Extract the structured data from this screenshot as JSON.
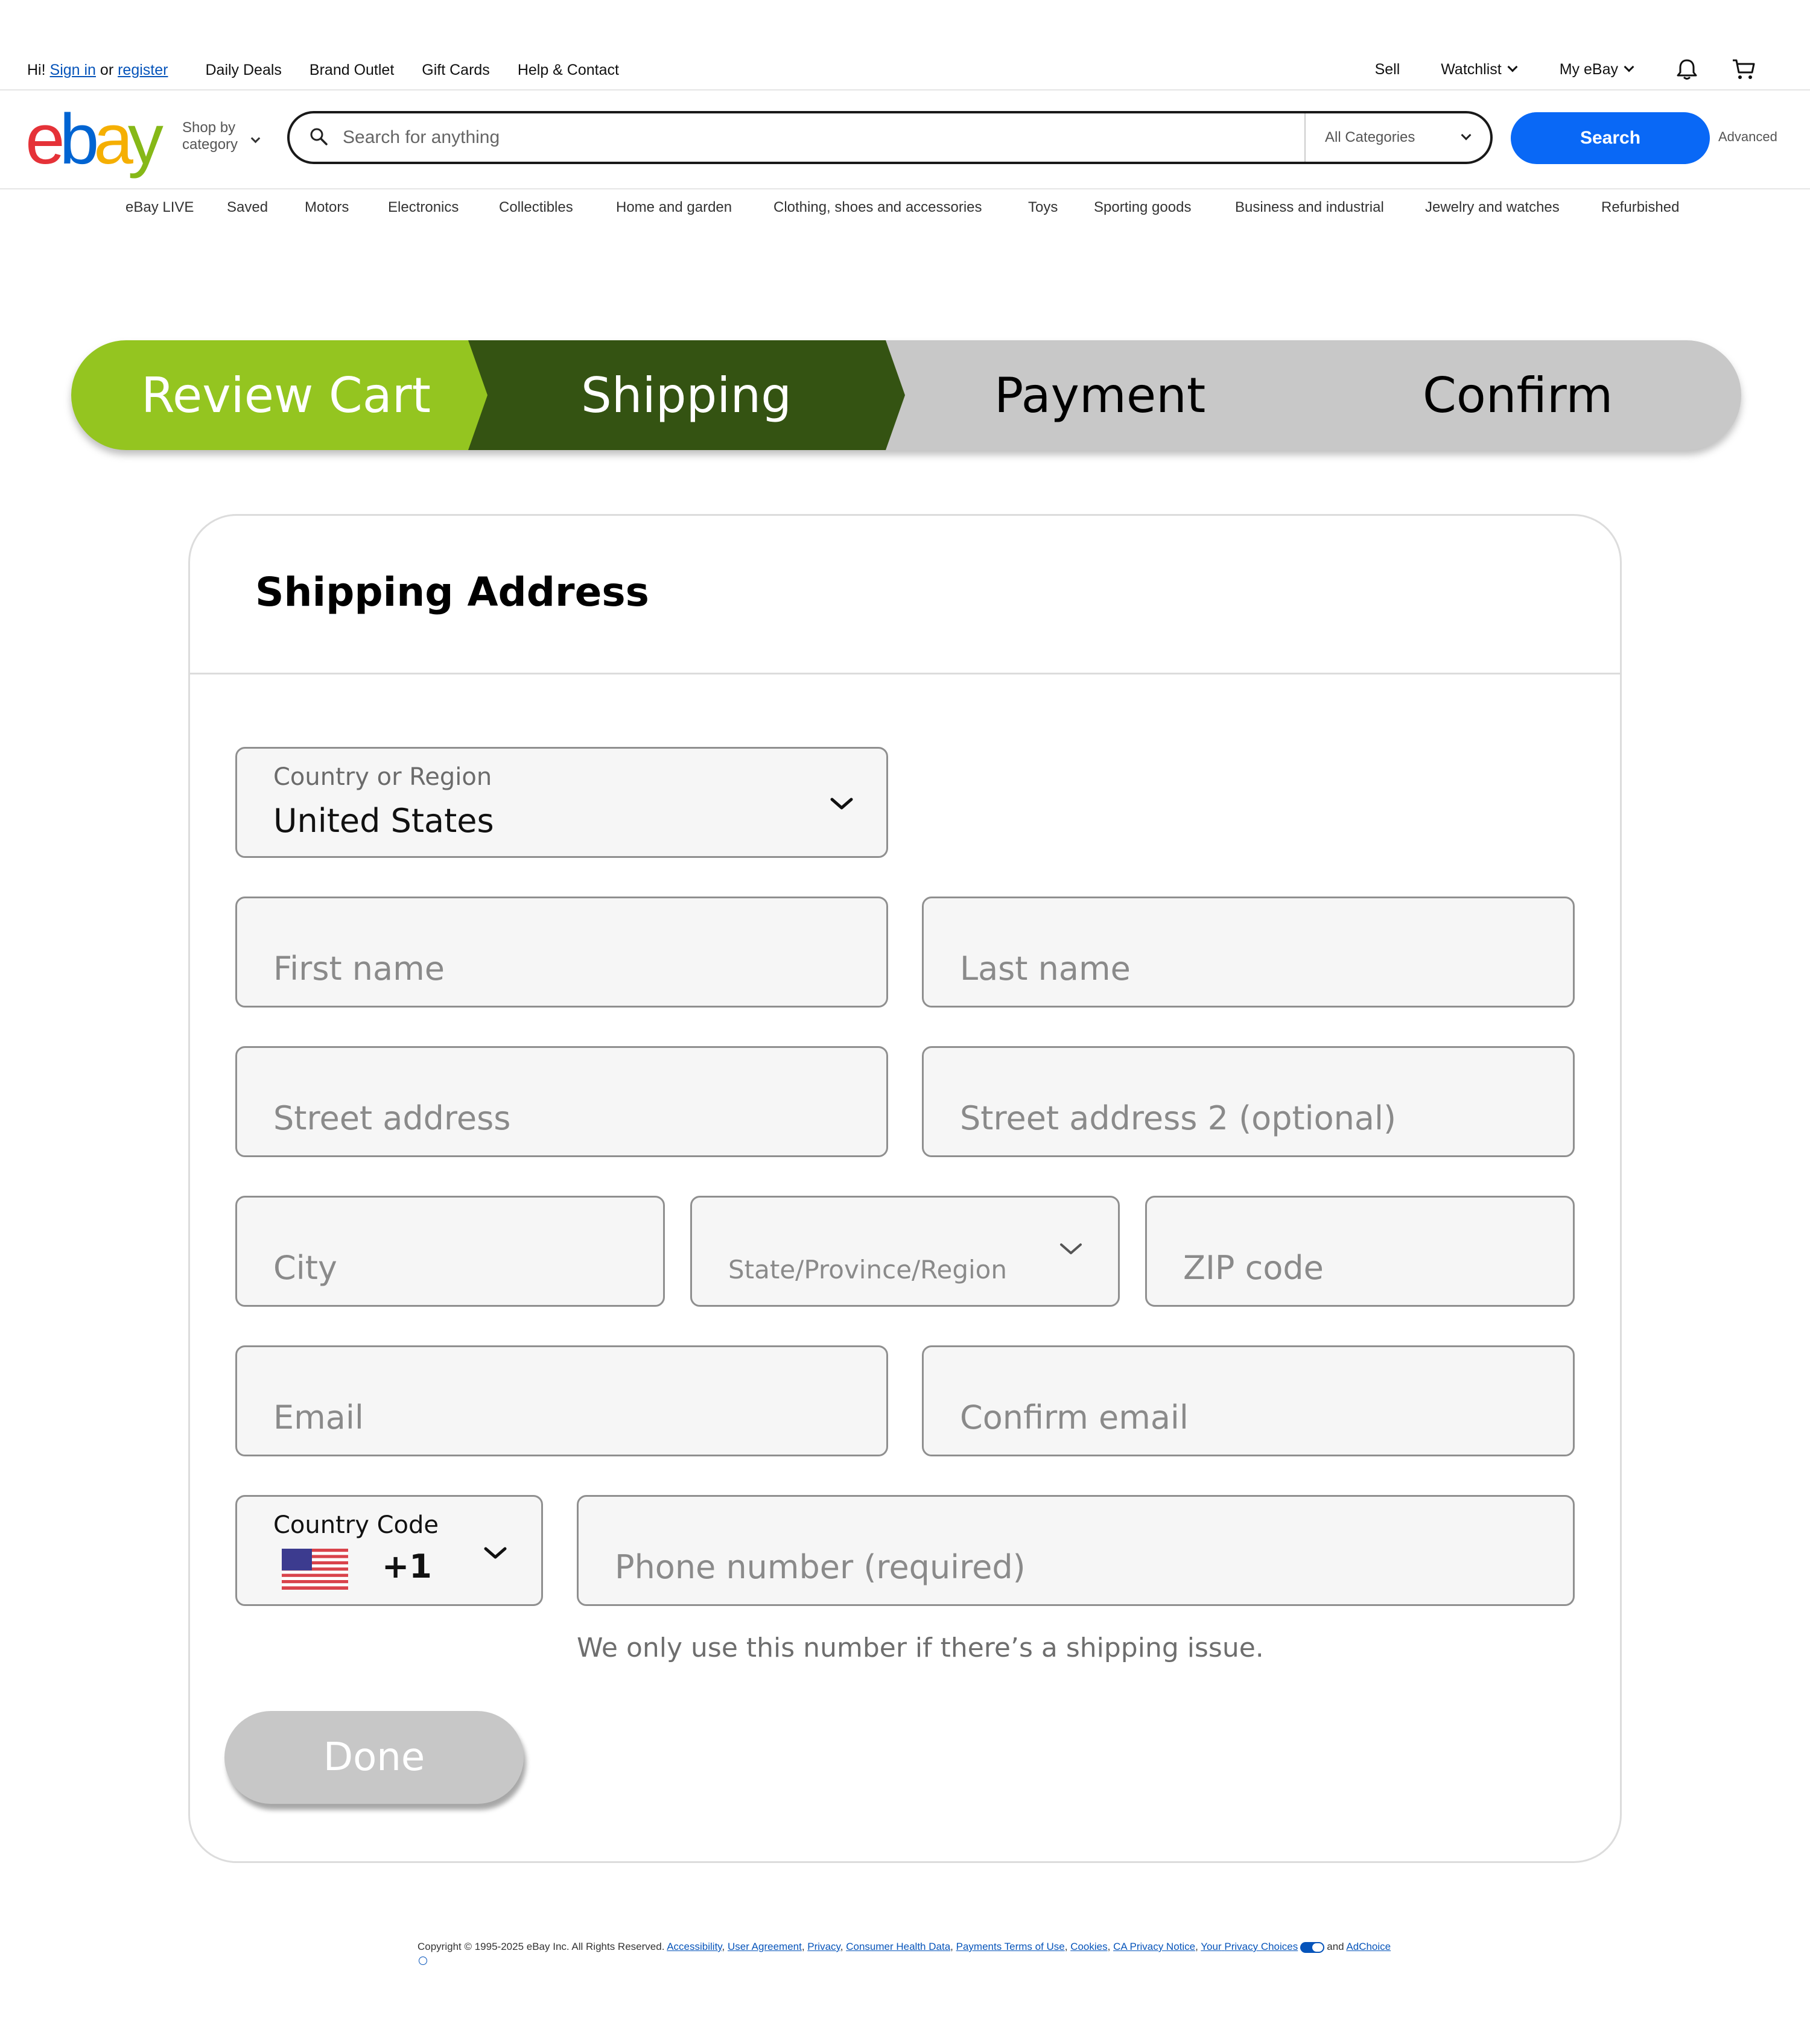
{
  "topbar": {
    "greeting_prefix": "Hi!",
    "sign_in": "Sign in",
    "or": "or",
    "register": "register",
    "links": [
      "Daily Deals",
      "Brand Outlet",
      "Gift Cards",
      "Help & Contact"
    ],
    "sell": "Sell",
    "watchlist": "Watchlist",
    "my_ebay": "My eBay"
  },
  "header": {
    "logo": {
      "e": "e",
      "b": "b",
      "a": "a",
      "y": "y"
    },
    "shop_by_line1": "Shop by",
    "shop_by_line2": "category",
    "search_placeholder": "Search for anything",
    "category_select": "All Categories",
    "search_button": "Search",
    "advanced": "Advanced"
  },
  "category_nav": [
    "eBay LIVE",
    "Saved",
    "Motors",
    "Electronics",
    "Collectibles",
    "Home and garden",
    "Clothing, shoes and accessories",
    "Toys",
    "Sporting goods",
    "Business and industrial",
    "Jewelry and watches",
    "Refurbished"
  ],
  "stepper": {
    "steps": [
      "Review Cart",
      "Shipping",
      "Payment",
      "Confirm"
    ],
    "active_step": "Shipping",
    "colors": {
      "completed": "#94c520",
      "active": "#345312",
      "pending": "#c8c8c8"
    }
  },
  "form": {
    "title": "Shipping Address",
    "country_label": "Country or Region",
    "country_value": "United States",
    "first_name": "First name",
    "last_name": "Last name",
    "street": "Street address",
    "street2": "Street address 2 (optional)",
    "city": "City",
    "state": "State/Province/Region",
    "zip": "ZIP code",
    "email": "Email",
    "confirm_email": "Confirm email",
    "country_code_label": "Country Code",
    "country_code_value": "+1",
    "phone": "Phone number (required)",
    "phone_helper": "We only use this number if there’s a shipping issue.",
    "done": "Done"
  },
  "footer": {
    "copyright": "Copyright © 1995-2025 eBay Inc. All Rights Reserved.",
    "links": [
      "Accessibility",
      "User Agreement",
      "Privacy",
      "Consumer Health Data",
      "Payments Terms of Use",
      "Cookies",
      "CA Privacy Notice"
    ],
    "your": "Your",
    "privacy_choices": "Privacy Choices",
    "and": "and",
    "adchoice": "AdChoice"
  },
  "icons": [
    "search-icon",
    "chevron-down-icon",
    "bell-icon",
    "cart-icon",
    "us-flag-icon",
    "privacy-choices-icon",
    "info-icon"
  ]
}
